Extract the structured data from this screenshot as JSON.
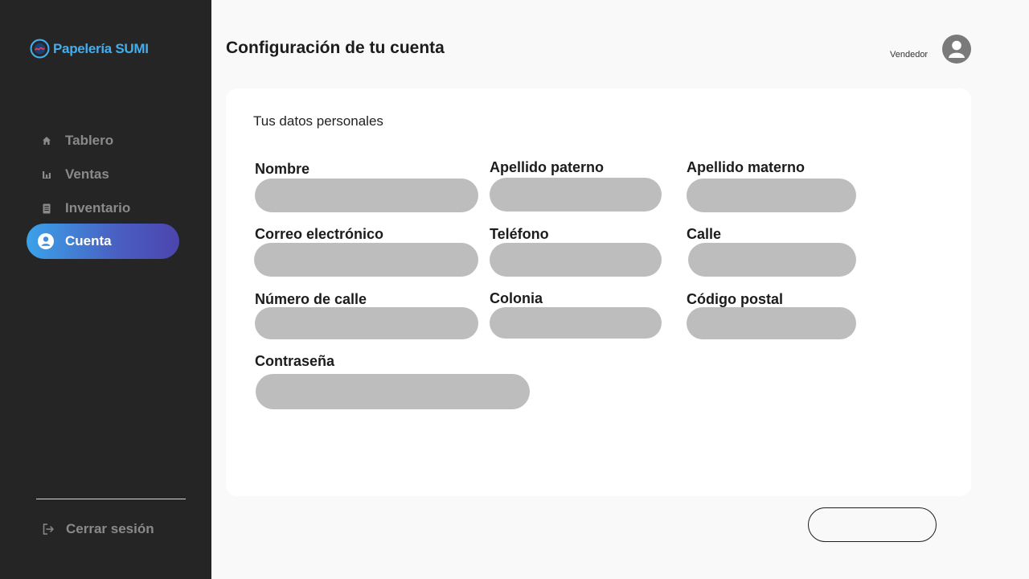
{
  "brand": {
    "name": "Papelería SUMI",
    "accent": "#41aef0"
  },
  "sidebar": {
    "items": [
      {
        "label": "Tablero",
        "icon": "home-icon"
      },
      {
        "label": "Ventas",
        "icon": "bar-chart-icon"
      },
      {
        "label": "Inventario",
        "icon": "document-icon"
      },
      {
        "label": "Cuenta",
        "icon": "user-circle-icon",
        "active": true
      }
    ],
    "logout": {
      "label": "Cerrar sesión",
      "icon": "logout-icon"
    }
  },
  "header": {
    "title": "Configuración de tu cuenta",
    "role": "Vendedor",
    "avatar_icon": "user-avatar-icon"
  },
  "form": {
    "section_title": "Tus datos personales",
    "fields": {
      "nombre": {
        "label": "Nombre",
        "value": ""
      },
      "apellido_paterno": {
        "label": "Apellido paterno",
        "value": ""
      },
      "apellido_materno": {
        "label": "Apellido materno",
        "value": ""
      },
      "correo": {
        "label": "Correo electrónico",
        "value": ""
      },
      "telefono": {
        "label": "Teléfono",
        "value": ""
      },
      "calle": {
        "label": "Calle",
        "value": ""
      },
      "numero_calle": {
        "label": "Número de calle",
        "value": ""
      },
      "colonia": {
        "label": "Colonia",
        "value": ""
      },
      "codigo_postal": {
        "label": "Código postal",
        "value": ""
      },
      "contrasena": {
        "label": "Contraseña",
        "value": ""
      }
    },
    "save_label": ""
  },
  "colors": {
    "sidebar_bg": "#252525",
    "active_gradient_start": "#3aa2e9",
    "active_gradient_end": "#4b45ad",
    "input_bg": "#bdbdbd"
  }
}
